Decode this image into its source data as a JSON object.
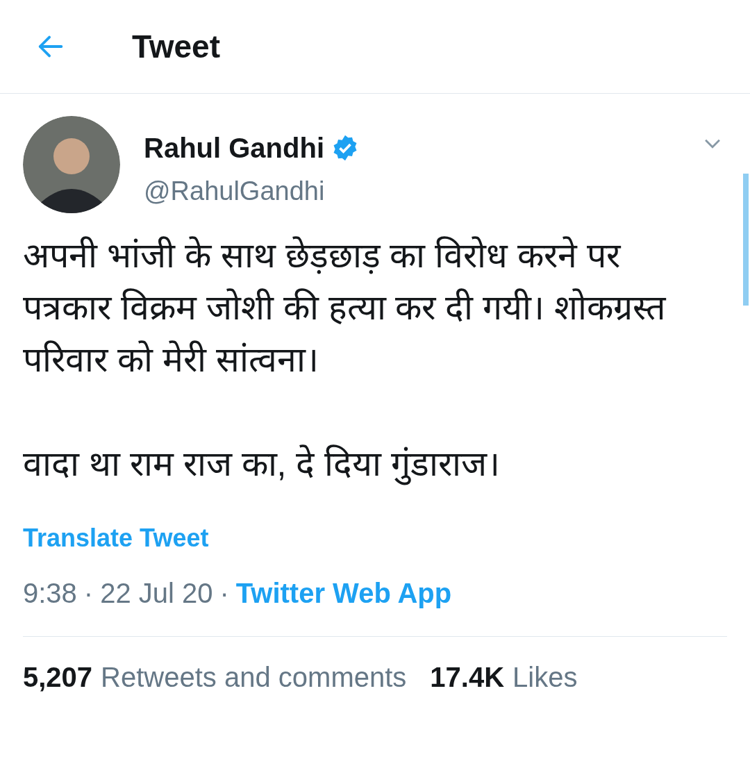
{
  "header": {
    "title": "Tweet"
  },
  "tweet": {
    "author": {
      "name": "Rahul Gandhi",
      "verified": true,
      "handle": "@RahulGandhi"
    },
    "paragraphs": [
      "अपनी भांजी के साथ छेड़छाड़ का विरोध करने पर पत्रकार विक्रम जोशी की हत्या कर दी गयी। शोकग्रस्त परिवार को मेरी सांत्वना।",
      "वादा था राम राज का, दे दिया गुंडाराज।"
    ],
    "translate_link": "Translate Tweet",
    "time": "9:38",
    "separator_1": "·",
    "date": "22 Jul 20",
    "separator_2": "·",
    "source": "Twitter Web App",
    "stats": [
      {
        "count": "5,207",
        "label": "Retweets and comments"
      },
      {
        "count": "17.4K",
        "label": "Likes"
      }
    ]
  }
}
